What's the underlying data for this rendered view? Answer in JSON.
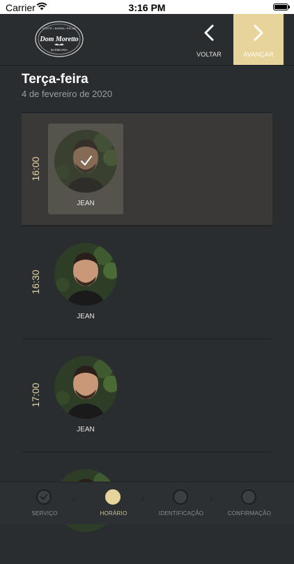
{
  "status_bar": {
    "carrier": "Carrier",
    "time": "3:16 PM"
  },
  "header": {
    "logo": {
      "top_text": "CORTE • BARBA • RELAX",
      "name": "Dom Moretto",
      "bottom_text": "BARBEARIA"
    },
    "back_label": "VOLTAR",
    "next_label": "AVANÇAR",
    "accent": "#e6d49a"
  },
  "day": {
    "title": "Terça-feira",
    "date": "4 de fevereiro de 2020"
  },
  "slots": [
    {
      "time": "16:00",
      "barber": "JEAN",
      "selected": true
    },
    {
      "time": "16:30",
      "barber": "JEAN",
      "selected": false
    },
    {
      "time": "17:00",
      "barber": "JEAN",
      "selected": false
    }
  ],
  "steps": [
    {
      "label": "SERVIÇO",
      "state": "done"
    },
    {
      "label": "HORÁRIO",
      "state": "active"
    },
    {
      "label": "IDENTIFICAÇÃO",
      "state": "pending"
    },
    {
      "label": "CONFIRMAÇÃO",
      "state": "pending"
    }
  ]
}
